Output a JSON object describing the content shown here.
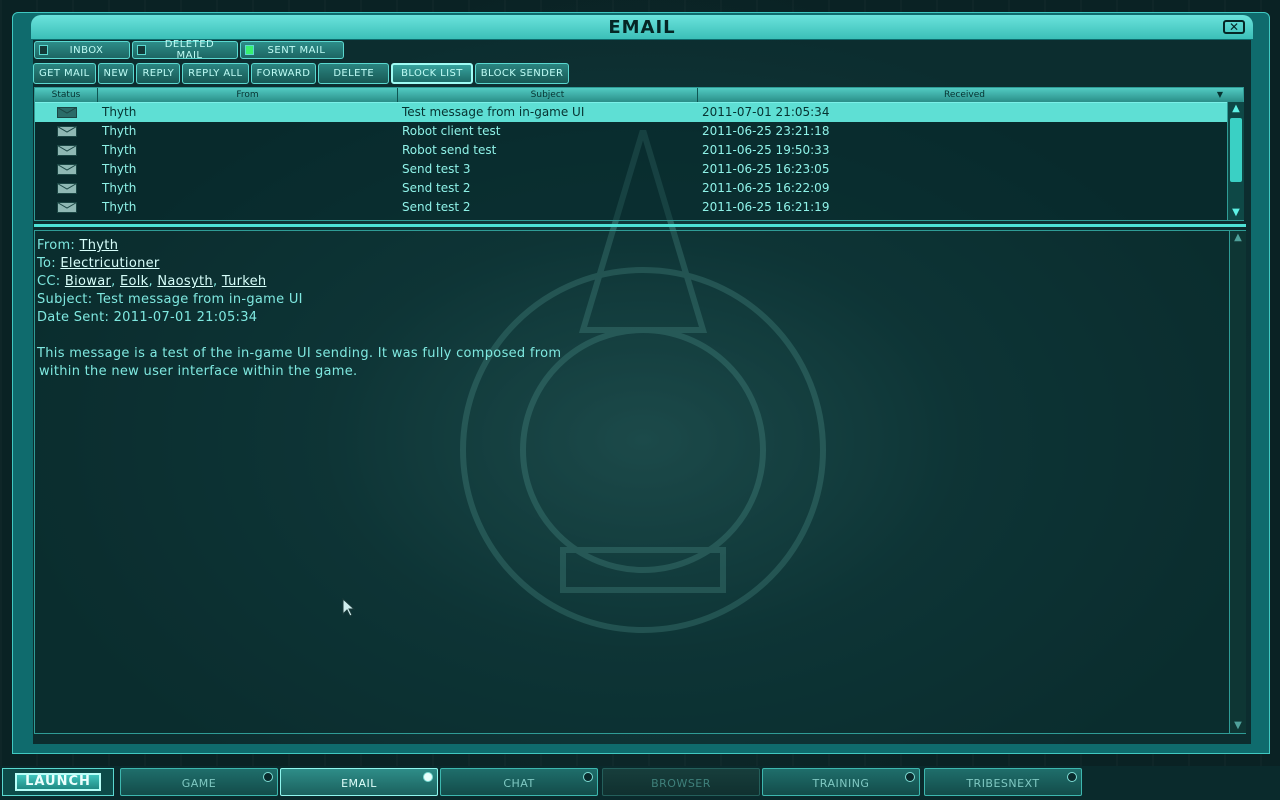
{
  "window": {
    "title": "EMAIL",
    "close_icon": "close-icon"
  },
  "folders": [
    {
      "label": "INBOX",
      "active": false
    },
    {
      "label": "DELETED MAIL",
      "active": false
    },
    {
      "label": "SENT MAIL",
      "active": true
    }
  ],
  "toolbar": {
    "get_mail": "GET MAIL",
    "new": "NEW",
    "reply": "REPLY",
    "reply_all": "REPLY ALL",
    "forward": "FORWARD",
    "delete": "DELETE",
    "block_list": "BLOCK LIST",
    "block_sender": "BLOCK SENDER"
  },
  "list": {
    "headers": {
      "status": "Status",
      "from": "From",
      "subject": "Subject",
      "received": "Received"
    },
    "rows": [
      {
        "from": "Thyth",
        "subject": "Test message from in-game UI",
        "received": "2011-07-01 21:05:34",
        "selected": true
      },
      {
        "from": "Thyth",
        "subject": "Robot client test",
        "received": "2011-06-25 23:21:18"
      },
      {
        "from": "Thyth",
        "subject": "Robot send test",
        "received": "2011-06-25 19:50:33"
      },
      {
        "from": "Thyth",
        "subject": "Send test 3",
        "received": "2011-06-25 16:23:05"
      },
      {
        "from": "Thyth",
        "subject": "Send test 2",
        "received": "2011-06-25 16:22:09"
      },
      {
        "from": "Thyth",
        "subject": "Send test 2",
        "received": "2011-06-25 16:21:19"
      }
    ]
  },
  "message": {
    "from_label": "From:",
    "from": "Thyth",
    "to_label": "To:",
    "to": "Electricutioner",
    "cc_label": "CC:",
    "cc": [
      "Biowar",
      "Eolk",
      "Naosyth",
      "Turkeh"
    ],
    "subject_label": "Subject:",
    "subject": "Test message from in-game UI",
    "date_label": "Date Sent:",
    "date": "2011-07-01 21:05:34",
    "body_line1": "This message is a test of the in-game UI sending. It was fully composed from",
    "body_line2": "within the new user interface within the game."
  },
  "bottom_nav": {
    "launch": "LAUNCH",
    "tabs": [
      "GAME",
      "EMAIL",
      "CHAT",
      "BROWSER",
      "TRAINING",
      "TRIBESNEXT"
    ]
  },
  "colors": {
    "accent": "#5edfd4",
    "panel": "#0f6b6d",
    "text": "#8ff2e8"
  }
}
